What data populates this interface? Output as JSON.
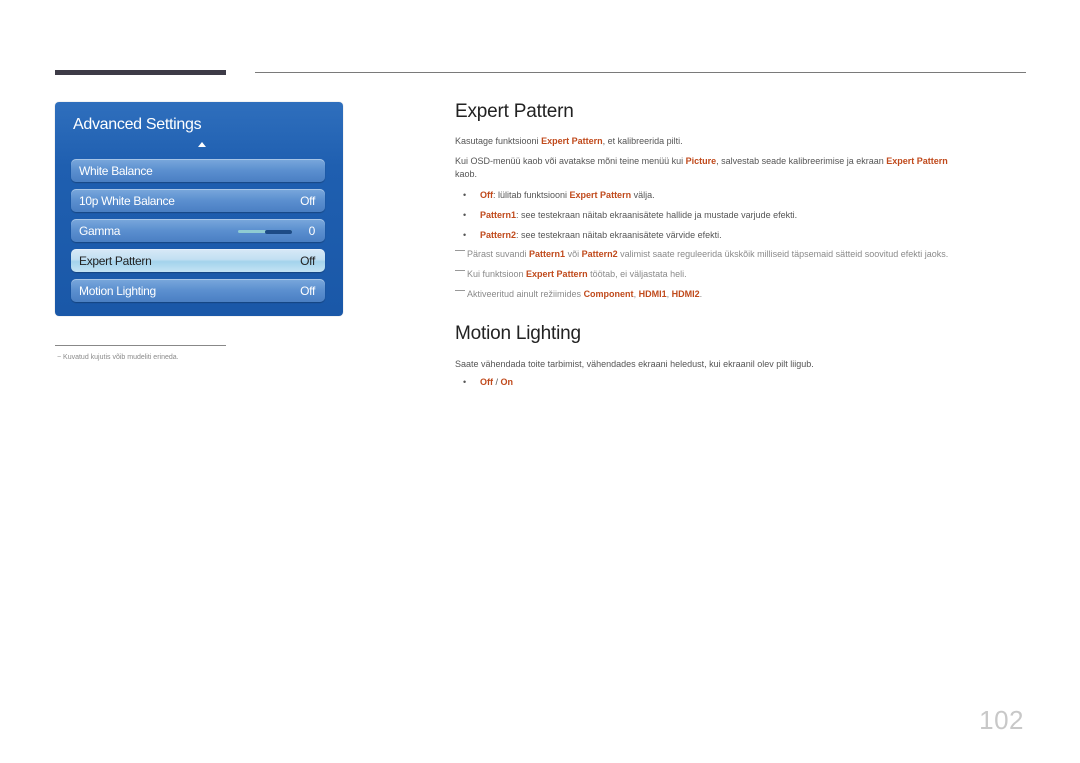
{
  "osd": {
    "title": "Advanced Settings",
    "items": [
      {
        "label": "White Balance",
        "value": ""
      },
      {
        "label": "10p White Balance",
        "value": "Off"
      },
      {
        "label": "Gamma",
        "value": "0",
        "slider_fraction": 0.5
      },
      {
        "label": "Expert Pattern",
        "value": "Off",
        "selected": true
      },
      {
        "label": "Motion Lighting",
        "value": "Off"
      }
    ]
  },
  "footnote": "−  Kuvatud kujutis võib mudeliti erineda.",
  "expert_pattern": {
    "heading": "Expert Pattern",
    "p1": {
      "a": "Kasutage funktsiooni ",
      "b": "Expert Pattern",
      "c": ", et kalibreerida pilti."
    },
    "p2": {
      "a": "Kui OSD-menüü kaob või avatakse mõni teine menüü kui ",
      "b": "Picture",
      "c": ", salvestab seade kalibreerimise ja ekraan ",
      "d": "Expert Pattern",
      "e": "kaob."
    },
    "bullets": [
      {
        "key": "Off",
        "a": ": lülitab funktsiooni ",
        "b": "Expert Pattern",
        "c": " välja."
      },
      {
        "key": "Pattern1",
        "a": ": see testekraan näitab ekraanisätete hallide ja mustade varjude efekti."
      },
      {
        "key": "Pattern2",
        "a": ": see testekraan näitab ekraanisätete värvide efekti."
      }
    ],
    "notes": [
      {
        "a": "Pärast suvandi ",
        "b": "Pattern1",
        "c": " või ",
        "d": "Pattern2",
        "e": " valimist saate reguleerida ükskõik milliseid täpsemaid sätteid soovitud efekti jaoks."
      },
      {
        "a": "Kui funktsioon ",
        "b": "Expert Pattern",
        "c": " töötab, ei väljastata heli."
      },
      {
        "a": "Aktiveeritud ainult režiimides ",
        "b": "Component",
        "c": ", ",
        "d": "HDMI1",
        "e": ", ",
        "f": "HDMI2",
        "g": "."
      }
    ]
  },
  "motion_lighting": {
    "heading": "Motion Lighting",
    "p1": "Saate vähendada toite tarbimist, vähendades ekraani heledust, kui ekraanil olev pilt liigub.",
    "options": {
      "a": "Off",
      "sep": " / ",
      "b": "On"
    }
  },
  "page_number": "102",
  "colors": {
    "accent": "#c04a1c",
    "osd_blue": "#1f5fb0"
  }
}
